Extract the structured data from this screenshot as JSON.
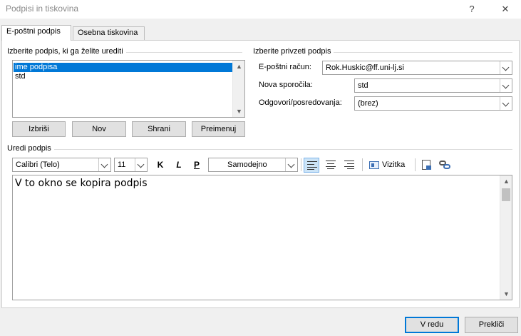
{
  "window": {
    "title": "Podpisi in tiskovina",
    "help_label": "?",
    "close_label": "✕"
  },
  "tabs": [
    {
      "label": "E-poštni podpis",
      "active": true
    },
    {
      "label": "Osebna tiskovina",
      "active": false
    }
  ],
  "select_signature": {
    "label": "Izberite podpis, ki ga želite urediti",
    "items": [
      {
        "label": "ime podpisa",
        "selected": true
      },
      {
        "label": "std",
        "selected": false
      }
    ],
    "buttons": {
      "delete": "Izbriši",
      "new": "Nov",
      "save": "Shrani",
      "rename": "Preimenuj"
    }
  },
  "default_signature": {
    "label": "Izberite privzeti podpis",
    "account_label": "E-poštni račun:",
    "account_value": "Rok.Huskic@ff.uni-lj.si",
    "new_messages_label": "Nova sporočila:",
    "new_messages_value": "std",
    "replies_label": "Odgovori/posredovanja:",
    "replies_value": "(brez)"
  },
  "edit_signature": {
    "label": "Uredi podpis",
    "font": "Calibri (Telo)",
    "size": "11",
    "bold": "K",
    "italic": "L",
    "underline": "P",
    "color": "Samodejno",
    "business_card": "Vizitka",
    "content": "V to okno se kopira podpis"
  },
  "footer": {
    "ok": "V redu",
    "cancel": "Prekliči"
  },
  "colors": {
    "accent": "#0078d7",
    "selection": "#0078d7"
  }
}
